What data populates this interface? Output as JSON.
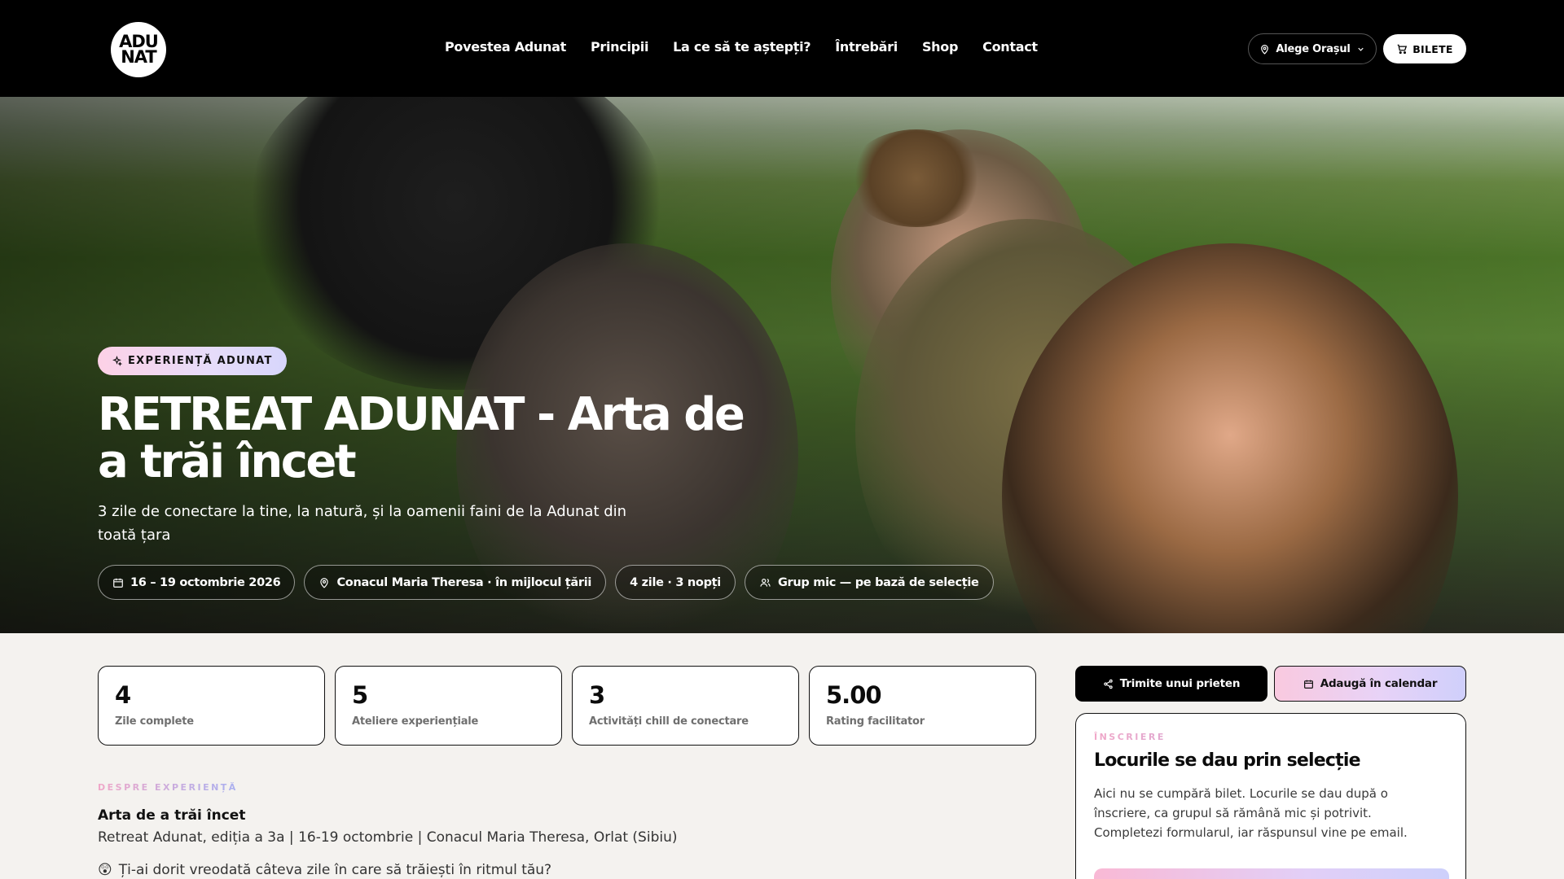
{
  "header": {
    "logo_text": [
      "ADU",
      "NAT"
    ],
    "nav": [
      {
        "label": "Povestea Adunat"
      },
      {
        "label": "Principii"
      },
      {
        "label": "La ce să te aștepți?"
      },
      {
        "label": "Întrebări"
      },
      {
        "label": "Shop"
      },
      {
        "label": "Contact"
      }
    ],
    "city_button": "Alege Orașul",
    "tickets_button": "BILETE"
  },
  "hero": {
    "badge": "EXPERIENȚĂ ADUNAT",
    "title": "RETREAT ADUNAT - Arta de a trăi încet",
    "subtitle": "3 zile de conectare la tine, la natură, și la oamenii faini de la Adunat din toată țara",
    "chips": [
      {
        "icon": "calendar-icon",
        "label": "16 – 19 octombrie 2026"
      },
      {
        "icon": "location-pin-icon",
        "label": "Conacul Maria Theresa · în mijlocul țării"
      },
      {
        "icon": "",
        "label": "4 zile · 3 nopți"
      },
      {
        "icon": "users-icon",
        "label": "Grup mic — pe bază de selecție"
      }
    ]
  },
  "stats": [
    {
      "value": "4",
      "label": "Zile complete"
    },
    {
      "value": "5",
      "label": "Ateliere experiențiale"
    },
    {
      "value": "3",
      "label": "Activități chill de conectare"
    },
    {
      "value": "5.00",
      "label": "Rating facilitator"
    }
  ],
  "about": {
    "kicker": "DESPRE EXPERIENȚĂ",
    "title": "Arta de a trăi încet",
    "line": "Retreat Adunat, ediția a 3a | 16-19 octombrie | Conacul Maria Theresa, Orlat (Sibiu)",
    "question_emoji": "😲",
    "question": "Ți-ai dorit vreodată câteva zile în care să trăiești în ritmul tău?"
  },
  "actions": {
    "share": "Trimite unui prieten",
    "calendar": "Adaugă în calendar"
  },
  "registration": {
    "kicker": "ÎNSCRIERE",
    "title": "Locurile se dau prin selecție",
    "text": "Aici nu se cumpără bilet. Locurile se dau după o înscriere, ca grupul să rămână mic și potrivit. Completezi formularul, iar răspunsul vine pe email."
  },
  "colors": {
    "header_bg": "#000000",
    "page_bg": "#f4f2ef",
    "accent_pink": "#f9c9df",
    "accent_lilac": "#cfcffb"
  }
}
